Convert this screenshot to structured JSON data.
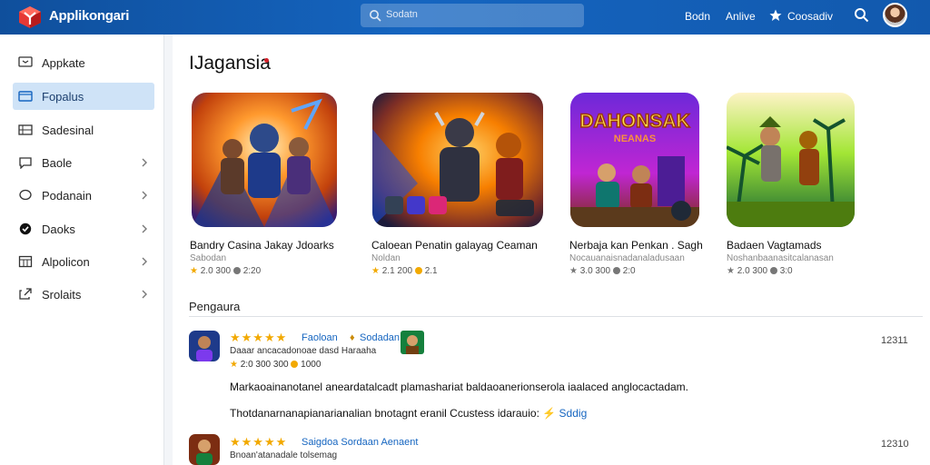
{
  "header": {
    "app_name": "Applikongari",
    "search_placeholder": "Sodatn",
    "nav": [
      "Bodn",
      "Anlive",
      "Coosadiv"
    ]
  },
  "sidebar": {
    "items": [
      {
        "label": "Appkate",
        "icon": "monitor-icon",
        "chevron": false
      },
      {
        "label": "Fopalus",
        "icon": "window-icon",
        "chevron": false
      },
      {
        "label": "Sadesinal",
        "icon": "grid-icon",
        "chevron": false
      },
      {
        "label": "Baole",
        "icon": "chat-icon",
        "chevron": true
      },
      {
        "label": "Podanain",
        "icon": "bubble-icon",
        "chevron": true
      },
      {
        "label": "Daoks",
        "icon": "check-circle-icon",
        "chevron": true
      },
      {
        "label": "Alpolicon",
        "icon": "calendar-icon",
        "chevron": true
      },
      {
        "label": "Srolaits",
        "icon": "share-icon",
        "chevron": true
      }
    ]
  },
  "main": {
    "title": "IJagansia",
    "cards": [
      {
        "title": "Bandry Casina Jakay Jdoarks",
        "sub": "Sabodan",
        "rating": "2.0 300",
        "count": "2:20"
      },
      {
        "title": "Caloean Penatin galayag Ceaman",
        "sub": "Noldan",
        "rating": "2.1 200",
        "count": "2.1"
      },
      {
        "title": "Nerbaja kan Penkan . Sagh",
        "sub": "Nocauanaisnadanaladusaan",
        "rating": "3.0 300",
        "count": "2:0"
      },
      {
        "title": "Badaen Vagtamads",
        "sub": "Noshanbaanasitcalanasan",
        "rating": "2.0 300",
        "count": "3:0"
      }
    ],
    "card_art": {
      "2": {
        "wordmark": "DAHONSAK",
        "subtitle": "NEANAS"
      }
    },
    "section_title": "Pengaura",
    "reviews": [
      {
        "stars": "★★★★★",
        "head": "Faoloan",
        "tag": "Sodadan",
        "sub": "Daaar ancacadonoae dasd Haraaha",
        "meta": "2:0 300 300",
        "meta2": "1000",
        "body": "Markaoainanotanel aneardatalcadt plamashariat baldaoanerionserola iaalaced anglocactadam.",
        "body2": "Thotdanarnanapianarianalian bnotagnt eranil Ccustess idarauio:",
        "link": "Sddig",
        "date": "12311"
      },
      {
        "stars": "★★★★★",
        "head": "Saigdoa Sordaan Aenaent",
        "sub": "Bnoan'atanadale tolsemag",
        "date": "12310"
      }
    ]
  },
  "colors": {
    "header": "#1565c0",
    "active": "#cfe3f7",
    "star": "#f2a900",
    "link": "#1565c0"
  }
}
